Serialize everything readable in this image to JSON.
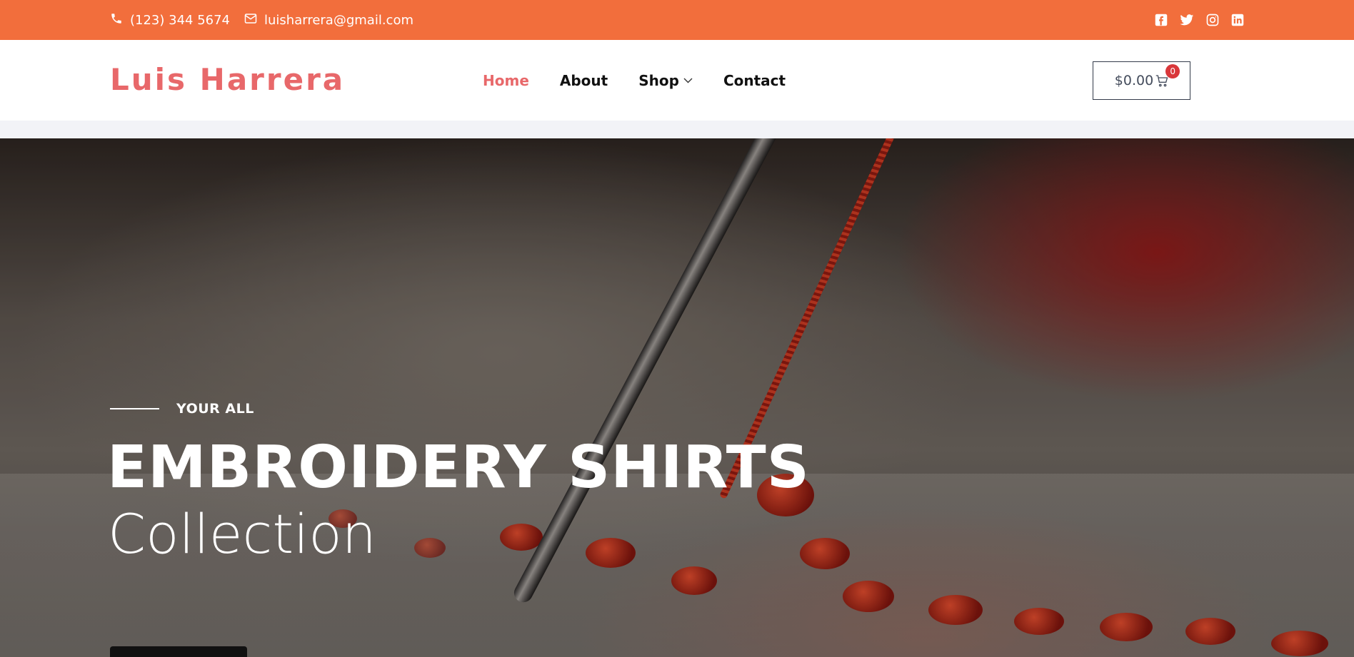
{
  "topbar": {
    "phone": "(123) 344 5674",
    "email": "luisharrera@gmail.com",
    "phone_icon": "phone-icon",
    "email_icon": "envelope-icon",
    "social_icons": [
      "facebook-icon",
      "twitter-icon",
      "instagram-icon",
      "linkedin-icon"
    ],
    "background_color": "#f26e3c"
  },
  "header": {
    "logo": "Luis Harrera",
    "logo_color": "#e8686a",
    "nav": [
      {
        "label": "Home",
        "active": true
      },
      {
        "label": "About",
        "active": false
      },
      {
        "label": "Shop",
        "active": false,
        "has_dropdown": true
      },
      {
        "label": "Contact",
        "active": false
      }
    ],
    "cart": {
      "total": "$0.00",
      "count": "0",
      "icon": "cart-icon"
    }
  },
  "hero": {
    "eyebrow": "YOUR ALL",
    "headline": "EMBROIDERY SHIRTS",
    "subline": "Collection"
  }
}
